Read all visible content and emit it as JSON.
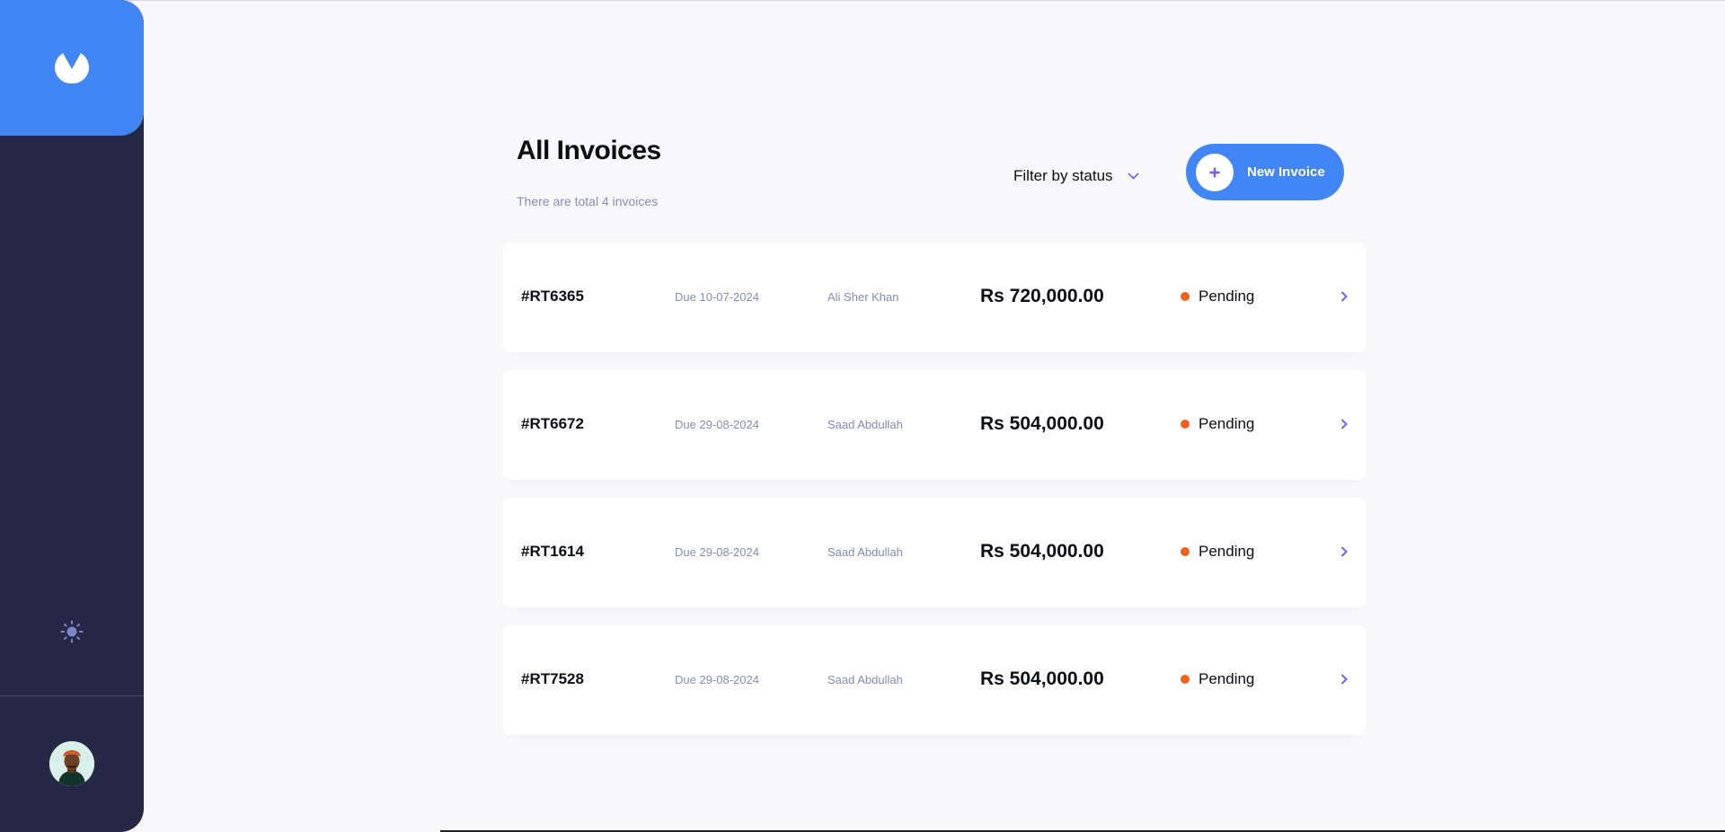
{
  "app": {
    "logo_icon": "app-logo-icon",
    "theme_icon": "sun-icon",
    "avatar_icon": "user-avatar",
    "accent_color": "#4286f5",
    "sidebar_color": "#252945",
    "status_color": "#f0611d",
    "arrow_color": "#7c5dfa"
  },
  "header": {
    "title": "All Invoices",
    "subtitle": "There are total 4 invoices",
    "filter_label": "Filter by status",
    "new_button_label": "New Invoice",
    "new_button_icon": "plus-icon"
  },
  "invoices": [
    {
      "id": "#RT6365",
      "due": "Due 10-07-2024",
      "client": "Ali Sher Khan",
      "amount": "Rs 720,000.00",
      "status": "Pending"
    },
    {
      "id": "#RT6672",
      "due": "Due 29-08-2024",
      "client": "Saad Abdullah",
      "amount": "Rs 504,000.00",
      "status": "Pending"
    },
    {
      "id": "#RT1614",
      "due": "Due 29-08-2024",
      "client": "Saad Abdullah",
      "amount": "Rs 504,000.00",
      "status": "Pending"
    },
    {
      "id": "#RT7528",
      "due": "Due 29-08-2024",
      "client": "Saad Abdullah",
      "amount": "Rs 504,000.00",
      "status": "Pending"
    }
  ]
}
